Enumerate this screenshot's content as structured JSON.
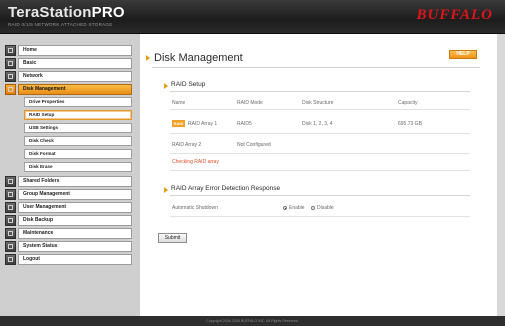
{
  "header": {
    "brand_name": "TeraStation",
    "brand_suffix": "PRO",
    "brand_tagline": "RAID 0/1/5 NETWORK ATTACHED STORAGE",
    "vendor_logo": "BUFFALO"
  },
  "sidebar": {
    "items": [
      {
        "label": "Home",
        "icon": "home-icon"
      },
      {
        "label": "Basic",
        "icon": "basic-icon"
      },
      {
        "label": "Network",
        "icon": "network-icon"
      },
      {
        "label": "Disk Management",
        "icon": "disk-icon",
        "active": true
      },
      {
        "label": "Shared Folders",
        "icon": "folder-icon"
      },
      {
        "label": "Group Management",
        "icon": "group-icon"
      },
      {
        "label": "User Management",
        "icon": "user-icon"
      },
      {
        "label": "Disk Backup",
        "icon": "backup-icon"
      },
      {
        "label": "Maintenance",
        "icon": "maintenance-icon"
      },
      {
        "label": "System Status",
        "icon": "status-icon"
      },
      {
        "label": "Logout",
        "icon": "logout-icon"
      }
    ],
    "sub_items": [
      {
        "label": "Drive Properties"
      },
      {
        "label": "RAID Setup",
        "active": true
      },
      {
        "label": "USB Settings"
      },
      {
        "label": "Disk Check"
      },
      {
        "label": "Disk Format"
      },
      {
        "label": "Disk Erase"
      }
    ]
  },
  "main": {
    "title": "Disk Management",
    "help_label": "HELP",
    "raid_setup": {
      "title": "RAID Setup",
      "columns": [
        "Name",
        "RAID Mode",
        "Disk Structure",
        "Capacity"
      ],
      "rows": [
        {
          "badge": "RAID",
          "name": "RAID Array 1",
          "mode": "RAID5",
          "structure": "Disk 1, 2, 3, 4",
          "capacity": "695.73 GB"
        },
        {
          "badge": "",
          "name": "RAID Array 2",
          "mode": "Not Configured",
          "structure": "",
          "capacity": ""
        }
      ],
      "status_text": "Checking RAID array"
    },
    "error_detection": {
      "title": "RAID Array Error Detection Response",
      "field_label": "Automatic Shutdown",
      "options": [
        "Enable",
        "Disable"
      ],
      "selected": "Enable"
    },
    "submit_label": "Submit"
  },
  "footer": {
    "copyright": "Copyright 2004-2006 BUFFALO INC. All Rights Reserved."
  },
  "colors": {
    "accent": "#ef9a17",
    "header_bg": "#222222",
    "vendor_red": "#e0141c",
    "status_red": "#e0502a"
  }
}
